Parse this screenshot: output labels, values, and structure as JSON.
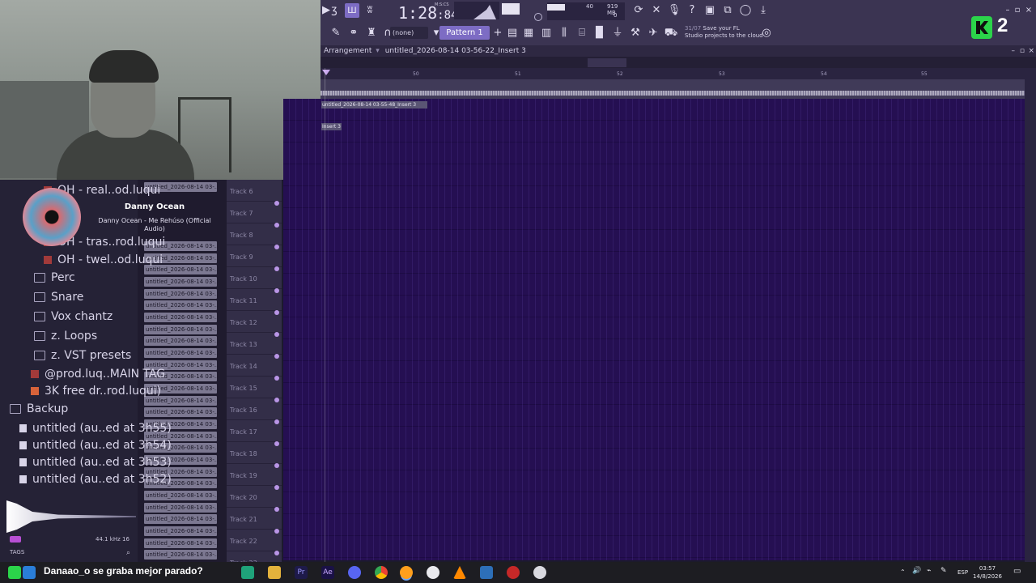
{
  "toolbar": {
    "time": "1:28",
    "time_ms": ":84",
    "time_label": "M:S:CS",
    "tempo_value": "40",
    "memory": "919 MB",
    "cpu_voices": "0",
    "none_selector": "(none)",
    "pattern_selector": "Pattern 1",
    "news_date": "31/07",
    "news_text_1": "Save your FL",
    "news_text_2": "Studio projects to the cloud",
    "overlay_badge": "2"
  },
  "arrangement": {
    "title": "Arrangement",
    "subtitle": "untitled_2026-08-14 03-56-22_Insert 3",
    "ruler_ticks": [
      "50",
      "51",
      "52",
      "53",
      "54",
      "55"
    ],
    "clip_top": "untitled_2026-08-14 03-55-48_Insert 3",
    "clip_second": "Insert 3"
  },
  "tracks": [
    "Track 6",
    "Track 7",
    "Track 8",
    "Track 9",
    "Track 10",
    "Track 11",
    "Track 12",
    "Track 13",
    "Track 14",
    "Track 15",
    "Track 16",
    "Track 17",
    "Track 18",
    "Track 19",
    "Track 20",
    "Track 21",
    "Track 22",
    "Track 23"
  ],
  "clip_list_label": "untitled_2026-08-14 03-...",
  "browser": {
    "items": [
      {
        "label": "OH - real..od.luqui",
        "icon": "audio-file-icon"
      },
      {
        "label": "OH - tras..rod.luqui",
        "icon": "audio-file-icon"
      },
      {
        "label": "OH - twel..od.luqui",
        "icon": "audio-file-icon"
      },
      {
        "label": "Perc",
        "icon": "folder-icon"
      },
      {
        "label": "Snare",
        "icon": "folder-icon"
      },
      {
        "label": "Vox chantz",
        "icon": "folder-icon"
      },
      {
        "label": "z. Loops",
        "icon": "folder-icon"
      },
      {
        "label": "z. VST presets",
        "icon": "folder-icon"
      },
      {
        "label": "@prod.luq..MAIN TAG",
        "icon": "audio-file-icon"
      },
      {
        "label": "3K free dr..rod.luqui)",
        "icon": "fl-project-icon"
      },
      {
        "label": "Backup",
        "icon": "folder-open-icon"
      },
      {
        "label": "untitled (au..ed at 3h55)",
        "icon": "file-icon"
      },
      {
        "label": "untitled (au..ed at 3h54)",
        "icon": "file-icon"
      },
      {
        "label": "untitled (au..ed at 3h53)",
        "icon": "file-icon"
      },
      {
        "label": "untitled (au..ed at 3h52)",
        "icon": "file-icon"
      }
    ],
    "sample_rate": "44.1 kHz 16",
    "tags": "TAGS"
  },
  "media_popup": {
    "artist": "Danny Ocean",
    "song": "Danny Ocean - Me Rehúso (Official Audio)"
  },
  "chat": {
    "user": "Danaao_o",
    "message": "se graba mejor parado?"
  },
  "taskbar": {
    "language": "ESP",
    "time": "03:57",
    "date": "14/8/2026"
  }
}
